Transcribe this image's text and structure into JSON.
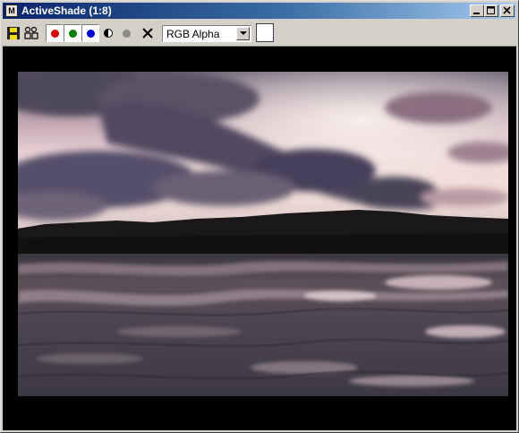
{
  "window": {
    "title": "ActiveShade (1:8)",
    "app_icon_label": "M"
  },
  "toolbar": {
    "channel_display": "RGB Alpha",
    "swatch_color": "#ffffff",
    "red_color": "#e00000",
    "green_color": "#008000",
    "blue_color": "#0000e0"
  },
  "viewport": {
    "background": "#000000"
  }
}
